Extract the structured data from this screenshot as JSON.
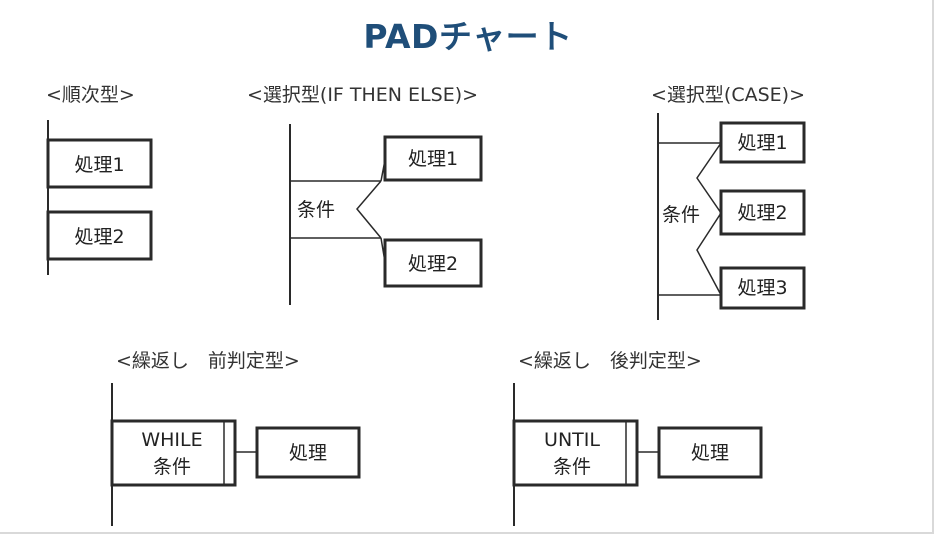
{
  "title": "PADチャート",
  "sequence": {
    "caption": "<順次型>",
    "box1": "処理1",
    "box2": "処理2"
  },
  "if_then_else": {
    "caption": "<選択型(IF THEN ELSE)>",
    "condition": "条件",
    "box1": "処理1",
    "box2": "処理2"
  },
  "case": {
    "caption": "<選択型(CASE)>",
    "condition": "条件",
    "box1": "処理1",
    "box2": "処理2",
    "box3": "処理3"
  },
  "pre_test_loop": {
    "caption": "<繰返し　前判定型>",
    "loop_keyword": "WHILE",
    "condition": "条件",
    "body": "処理"
  },
  "post_test_loop": {
    "caption": "<繰返し　後判定型>",
    "loop_keyword": "UNTIL",
    "condition": "条件",
    "body": "処理"
  }
}
